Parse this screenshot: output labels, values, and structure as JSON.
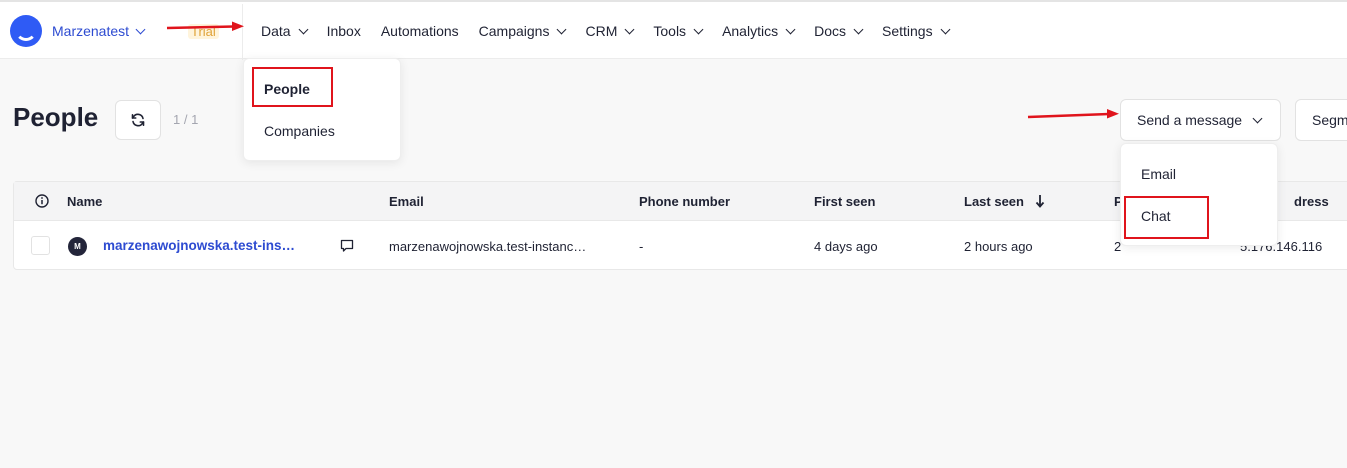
{
  "workspace": {
    "name": "Marzenatest",
    "trial_badge": "Trial"
  },
  "nav": {
    "items": [
      {
        "label": "Data",
        "has_menu": true
      },
      {
        "label": "Inbox",
        "has_menu": false
      },
      {
        "label": "Automations",
        "has_menu": false
      },
      {
        "label": "Campaigns",
        "has_menu": true
      },
      {
        "label": "CRM",
        "has_menu": true
      },
      {
        "label": "Tools",
        "has_menu": true
      },
      {
        "label": "Analytics",
        "has_menu": true
      },
      {
        "label": "Docs",
        "has_menu": true
      },
      {
        "label": "Settings",
        "has_menu": true
      }
    ]
  },
  "data_menu": {
    "items": [
      "People",
      "Companies"
    ],
    "highlighted": "People"
  },
  "page": {
    "title": "People",
    "count": "1 / 1"
  },
  "actions": {
    "send_message": "Send a message",
    "segments": "Segm"
  },
  "send_menu": {
    "items": [
      "Email",
      "Chat"
    ],
    "highlighted": "Chat"
  },
  "table": {
    "headers": [
      "Name",
      "Email",
      "Phone number",
      "First seen",
      "Last seen",
      "P",
      "dress"
    ],
    "sorted_column": "Last seen",
    "rows": [
      {
        "avatar": "M",
        "name": "marzenawojnowska.test-ins…",
        "email": "marzenawojnowska.test-instanc…",
        "phone": "-",
        "first_seen": "4 days ago",
        "last_seen": "2 hours ago",
        "p": "2",
        "address": "5.176.146.116"
      }
    ]
  },
  "colors": {
    "brand": "#2f5bf5",
    "link": "#2d4bd1",
    "annotation": "#e0141c",
    "trial": "#e0a33a"
  },
  "icons": [
    "chevron-down-icon",
    "refresh-icon",
    "info-icon",
    "sort-down-arrow-icon",
    "chat-bubble-icon"
  ]
}
